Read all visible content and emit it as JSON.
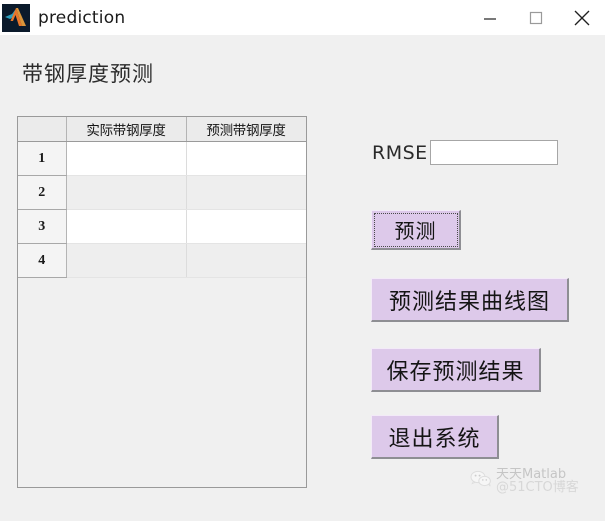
{
  "window": {
    "title": "prediction",
    "app_icon": "matlab-icon",
    "controls": {
      "minimize": "minimize-icon",
      "maximize": "maximize-icon",
      "close": "close-icon"
    }
  },
  "heading": "带钢厚度预测",
  "table": {
    "corner_header": "",
    "columns": [
      "实际带钢厚度",
      "预测带钢厚度"
    ],
    "rows": [
      {
        "num": "1",
        "actual": "",
        "predicted": ""
      },
      {
        "num": "2",
        "actual": "",
        "predicted": ""
      },
      {
        "num": "3",
        "actual": "",
        "predicted": ""
      },
      {
        "num": "4",
        "actual": "",
        "predicted": ""
      }
    ]
  },
  "rmse": {
    "label": "RMSE",
    "value": "",
    "placeholder": ""
  },
  "buttons": {
    "predict": "预测",
    "curve": "预测结果曲线图",
    "save": "保存预测结果",
    "exit": "退出系统"
  },
  "watermark": {
    "icon": "wechat-icon",
    "line1": "天天Matlab",
    "line2": "@51CTO博客"
  },
  "colors": {
    "window_background": "#f0f0f0",
    "titlebar_background": "#ffffff",
    "button_fill": "#ddc9ea",
    "panel_border": "#9a9a9a",
    "row_white": "#ffffff",
    "row_gray": "#eeeeee",
    "header_gray": "#ebebeb"
  }
}
